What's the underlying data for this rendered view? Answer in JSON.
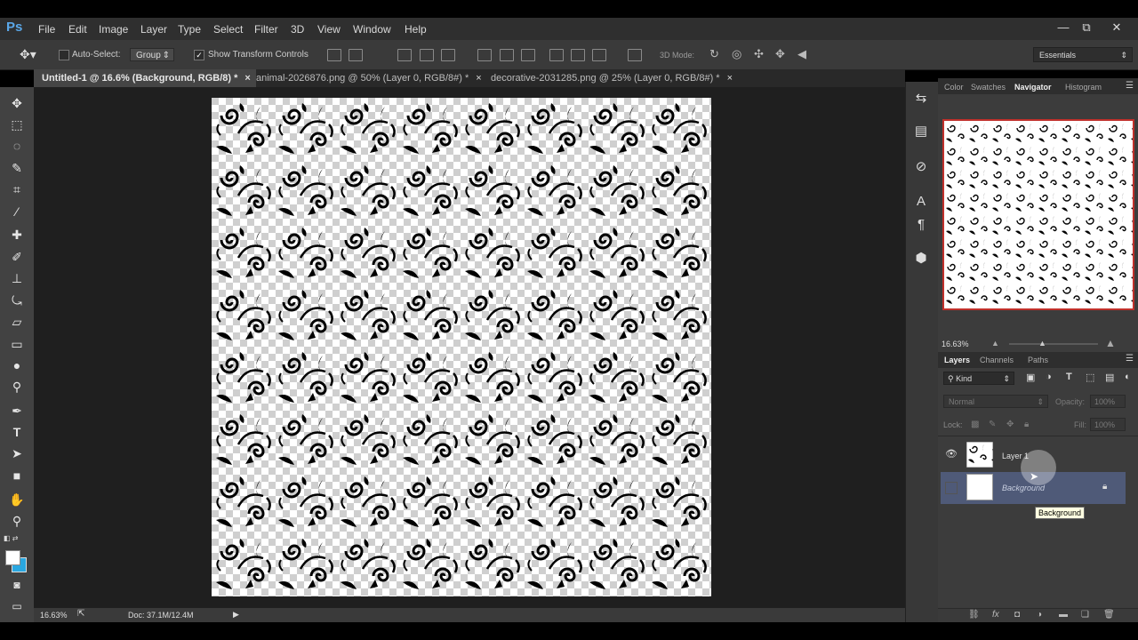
{
  "app": {
    "logo": "Ps"
  },
  "menu": [
    "File",
    "Edit",
    "Image",
    "Layer",
    "Type",
    "Select",
    "Filter",
    "3D",
    "View",
    "Window",
    "Help"
  ],
  "window_controls": {
    "minimize": "—",
    "restore": "⧉",
    "close": "✕"
  },
  "options": {
    "auto_select_label": "Auto-Select:",
    "auto_select_value": "Group",
    "show_transform_label": "Show Transform Controls",
    "mode_3d_label": "3D Mode:",
    "workspace": "Essentials"
  },
  "tabs": [
    {
      "label": "Untitled-1 @ 16.6% (Background, RGB/8) *",
      "close": "×"
    },
    {
      "label": "animal-2026876.png @ 50% (Layer 0, RGB/8#) *",
      "close": "×"
    },
    {
      "label": "decorative-2031285.png @ 25% (Layer 0, RGB/8#) *",
      "close": "×"
    }
  ],
  "status": {
    "zoom": "16.63%",
    "doc": "Doc: 37.1M/12.4M"
  },
  "navigator_tabs": [
    "Color",
    "Swatches",
    "Navigator",
    "Histogram"
  ],
  "navigator_zoom": "16.63%",
  "layers_tabs": [
    "Layers",
    "Channels",
    "Paths"
  ],
  "layers": {
    "filter_kind": "Kind",
    "blend_mode": "Normal",
    "opacity_label": "Opacity:",
    "opacity_value": "100%",
    "lock_label": "Lock:",
    "fill_label": "Fill:",
    "fill_value": "100%",
    "items": [
      {
        "name": "Layer 1"
      },
      {
        "name": "Background"
      }
    ],
    "tooltip": "Background"
  },
  "colors": {
    "accent": "#5aa7e8",
    "selected_row": "#4f5a78",
    "nav_border": "#c0302b",
    "background_swatch": "#2aa7e0"
  }
}
